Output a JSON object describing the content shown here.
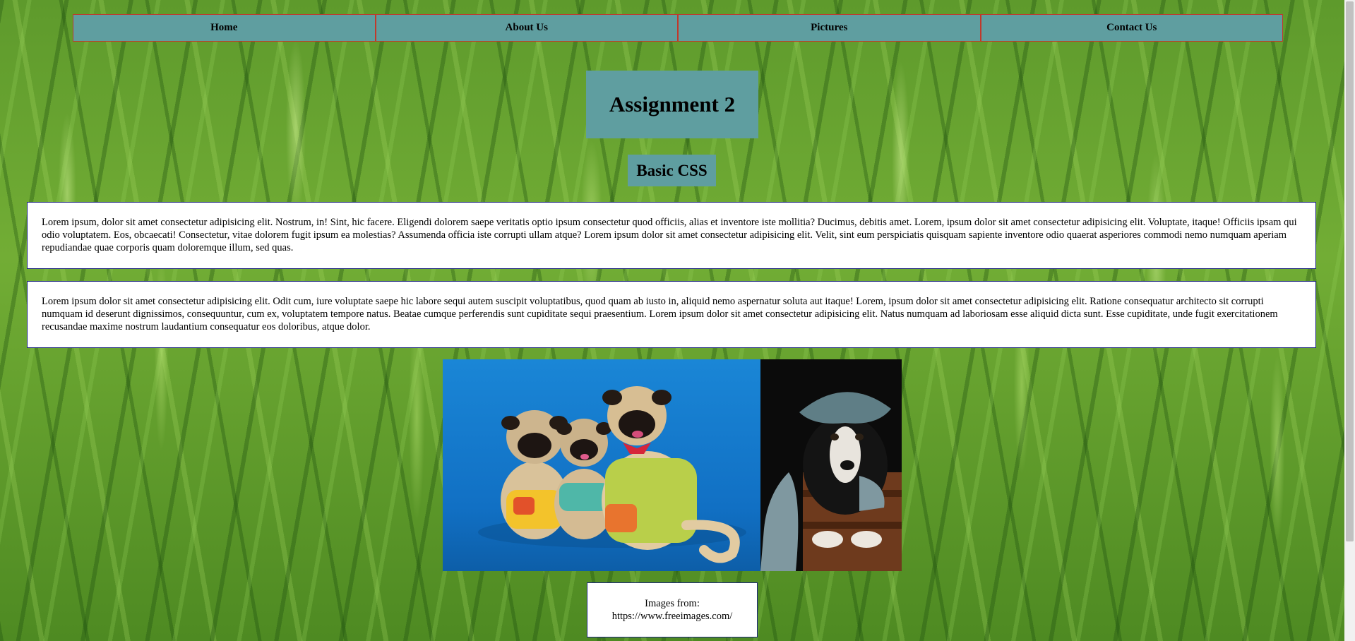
{
  "nav": {
    "items": [
      {
        "label": "Home"
      },
      {
        "label": "About Us"
      },
      {
        "label": "Pictures"
      },
      {
        "label": "Contact Us"
      }
    ]
  },
  "header": {
    "title": "Assignment 2",
    "subtitle": "Basic CSS"
  },
  "content": {
    "paragraph1": "Lorem ipsum, dolor sit amet consectetur adipisicing elit. Nostrum, in! Sint, hic facere. Eligendi dolorem saepe veritatis optio ipsum consectetur quod officiis, alias et inventore iste mollitia? Ducimus, debitis amet. Lorem, ipsum dolor sit amet consectetur adipisicing elit. Voluptate, itaque! Officiis ipsam qui odio voluptatem. Eos, obcaecati! Consectetur, vitae dolorem fugit ipsum ea molestias? Assumenda officia iste corrupti ullam atque? Lorem ipsum dolor sit amet consectetur adipisicing elit. Velit, sint eum perspiciatis quisquam sapiente inventore odio quaerat asperiores commodi nemo numquam aperiam repudiandae quae corporis quam doloremque illum, sed quas.",
    "paragraph2": "Lorem ipsum dolor sit amet consectetur adipisicing elit. Odit cum, iure voluptate saepe hic labore sequi autem suscipit voluptatibus, quod quam ab iusto in, aliquid nemo aspernatur soluta aut itaque! Lorem, ipsum dolor sit amet consectetur adipisicing elit. Ratione consequatur architecto sit corrupti numquam id deserunt dignissimos, consequuntur, cum ex, voluptatem tempore natus. Beatae cumque perferendis sunt cupiditate sequi praesentium. Lorem ipsum dolor sit amet consectetur adipisicing elit. Natus numquam ad laboriosam esse aliquid dicta sunt. Esse cupiditate, unde fugit exercitationem recusandae maxime nostrum laudantium consequatur eos doloribus, atque dolor."
  },
  "images": [
    {
      "name": "pugs-photo"
    },
    {
      "name": "dog-in-hat-photo"
    }
  ],
  "caption": {
    "line1": "Images from:",
    "line2": "https://www.freeimages.com/"
  },
  "colors": {
    "box_bg": "#5f9ea0",
    "nav_border": "#c0392b",
    "para_border": "#1a237e"
  }
}
